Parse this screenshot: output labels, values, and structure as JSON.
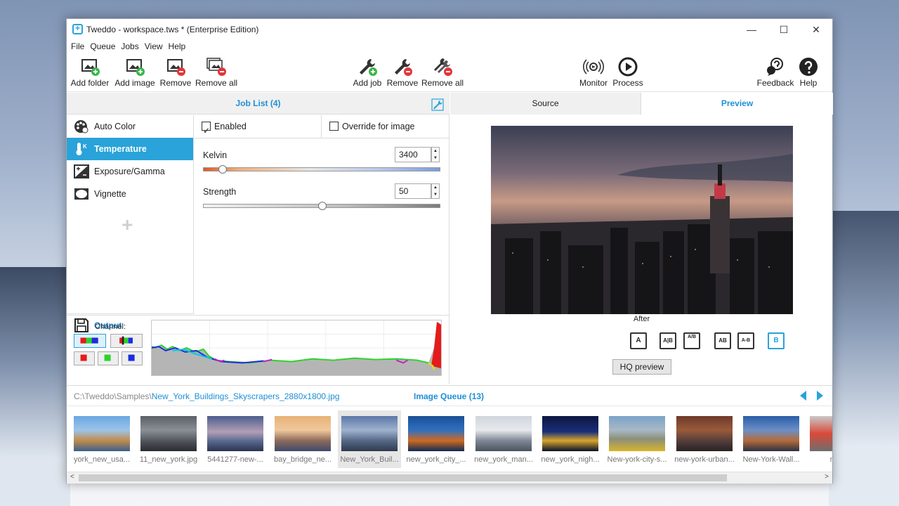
{
  "window": {
    "title": "Tweddo - workspace.tws * (Enterprise Edition)",
    "minimize": "—",
    "maximize": "☐",
    "close": "✕"
  },
  "menu": [
    "File",
    "Queue",
    "Jobs",
    "View",
    "Help"
  ],
  "toolbar": {
    "add_folder": "Add folder",
    "add_image": "Add image",
    "remove": "Remove",
    "remove_all": "Remove all",
    "add_job": "Add job",
    "remove_job": "Remove",
    "remove_all_jobs": "Remove all",
    "monitor": "Monitor",
    "process": "Process",
    "feedback": "Feedback",
    "help": "Help"
  },
  "job_list": {
    "title": "Job List (4)",
    "items": [
      "Auto Color",
      "Temperature",
      "Exposure/Gamma",
      "Vignette"
    ],
    "active_index": 1,
    "add_symbol": "+",
    "output": "Output"
  },
  "settings": {
    "enabled_label": "Enabled",
    "enabled": true,
    "override_label": "Override for image",
    "override": false,
    "kelvin_label": "Kelvin",
    "kelvin_value": "3400",
    "kelvin_fraction": 0.08,
    "strength_label": "Strength",
    "strength_value": "50",
    "strength_fraction": 0.5
  },
  "histogram": {
    "channel_label": "Channel:"
  },
  "preview": {
    "tab_source": "Source",
    "tab_preview": "Preview",
    "after_label": "After",
    "view_buttons": [
      "A",
      "A|B",
      "A/B",
      "AB",
      "A-B",
      "B"
    ],
    "hq_button": "HQ preview"
  },
  "queue": {
    "path_prefix": "C:\\Tweddo\\Samples\\",
    "path_file": "New_York_Buildings_Skyscrapers_2880x1800.jpg",
    "title": "Image Queue (13)",
    "selected_index": 4,
    "items": [
      "york_new_usa...",
      "11_new_york.jpg",
      "5441277-new-...",
      "bay_bridge_ne...",
      "New_York_Buil...",
      "new_york_city_...",
      "new_york_man...",
      "new_york_nigh...",
      "New-york-city-s...",
      "new-york-urban...",
      "New-York-Wall...",
      "nurZ"
    ]
  },
  "colors": {
    "accent": "#29a3d9",
    "accent_text": "#1f8fd6"
  }
}
